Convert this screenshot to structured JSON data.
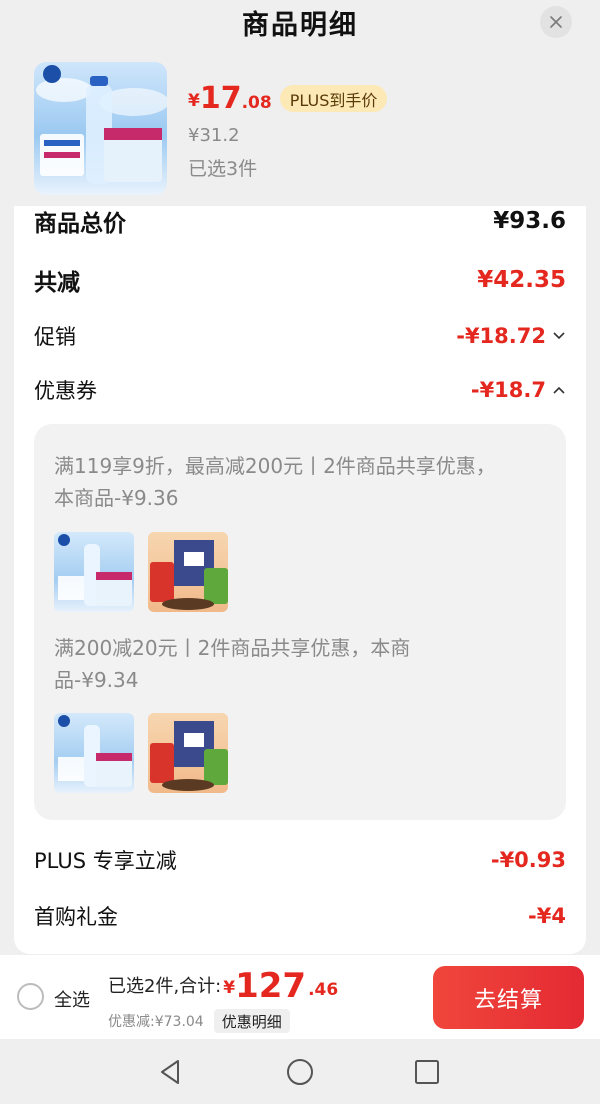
{
  "header": {
    "title": "商品明细"
  },
  "product": {
    "price_symbol": "¥",
    "price_int": "17",
    "price_dec": ".08",
    "plus_badge": "PLUS到手价",
    "original_price": "¥31.2",
    "selected": "已选3件"
  },
  "summary": {
    "total_label": "商品总价",
    "total_value": "¥93.6",
    "reduced_label": "共减",
    "reduced_value": "¥42.35",
    "promo_label": "促销",
    "promo_value": "-¥18.72",
    "coupon_label": "优惠券",
    "coupon_value": "-¥18.7",
    "plus_label": "PLUS 专享立减",
    "plus_value": "-¥0.93",
    "firstbuy_label": "首购礼金",
    "firstbuy_value": "-¥4"
  },
  "coupons": [
    {
      "text_line1": "满119享9折，最高减200元丨2件商品共享优惠，",
      "text_line2": "本商品-¥9.36"
    },
    {
      "text_line1": "满200减20元丨2件商品共享优惠，本商",
      "text_line2": "品-¥9.34"
    }
  ],
  "bottom": {
    "select_all": "全选",
    "total_label": "已选2件,合计:",
    "total_symbol": "¥",
    "total_int": "127",
    "total_dec": ".46",
    "discount": "优惠减:¥73.04",
    "detail_button": "优惠明细",
    "checkout_button": "去结算"
  },
  "colors": {
    "accent_red": "#e4281f",
    "plus_gold": "#fde9b6"
  },
  "icons": [
    "close-icon",
    "chevron-down-icon",
    "chevron-up-icon",
    "back-icon",
    "home-icon",
    "recents-icon"
  ]
}
